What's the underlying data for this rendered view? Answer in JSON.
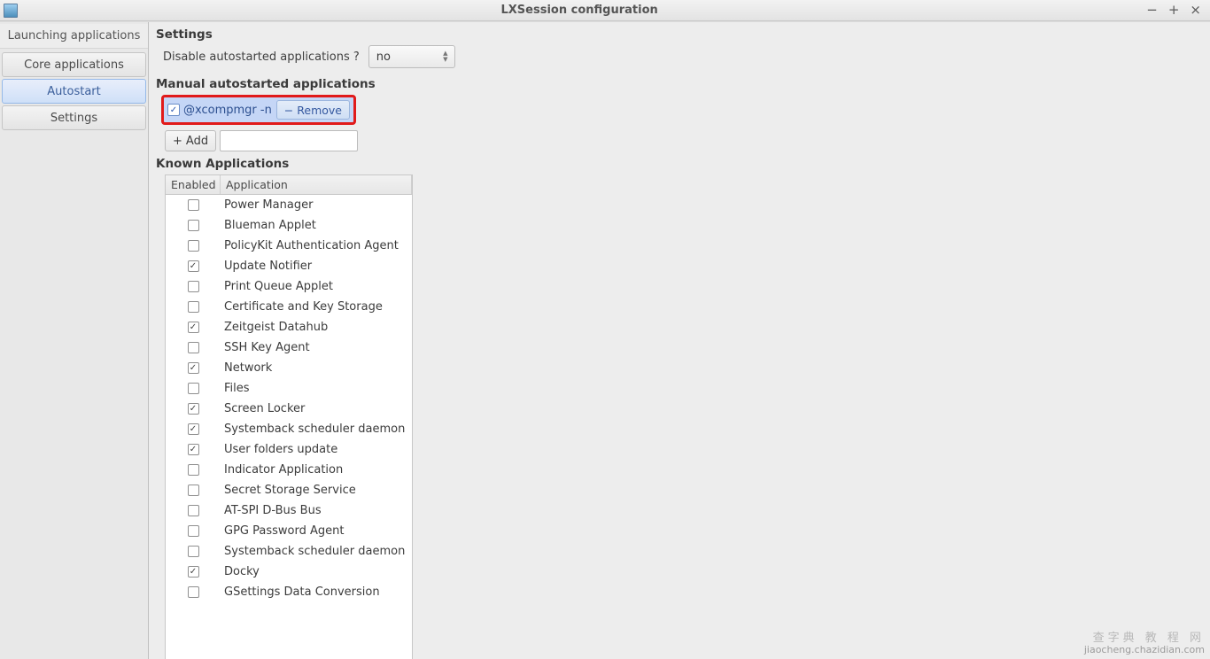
{
  "window": {
    "title": "LXSession configuration"
  },
  "sidebar": {
    "items": [
      {
        "label": "Launching applications",
        "kind": "top"
      },
      {
        "label": "Core applications",
        "kind": "normal"
      },
      {
        "label": "Autostart",
        "kind": "active"
      },
      {
        "label": "Settings",
        "kind": "normal"
      }
    ]
  },
  "settings": {
    "heading": "Settings",
    "disable_label": "Disable autostarted applications ?",
    "disable_value": "no"
  },
  "manual": {
    "heading": "Manual autostarted applications",
    "entry_label": "@xcompmgr -n",
    "entry_checked": true,
    "remove_label": "Remove",
    "add_label": "Add",
    "add_value": ""
  },
  "known": {
    "heading": "Known Applications",
    "col_enabled": "Enabled",
    "col_app": "Application",
    "rows": [
      {
        "enabled": false,
        "name": "Power Manager"
      },
      {
        "enabled": false,
        "name": "Blueman Applet"
      },
      {
        "enabled": false,
        "name": "PolicyKit Authentication Agent"
      },
      {
        "enabled": true,
        "name": "Update Notifier"
      },
      {
        "enabled": false,
        "name": "Print Queue Applet"
      },
      {
        "enabled": false,
        "name": "Certificate and Key Storage"
      },
      {
        "enabled": true,
        "name": "Zeitgeist Datahub"
      },
      {
        "enabled": false,
        "name": "SSH Key Agent"
      },
      {
        "enabled": true,
        "name": "Network"
      },
      {
        "enabled": false,
        "name": "Files"
      },
      {
        "enabled": true,
        "name": "Screen Locker"
      },
      {
        "enabled": true,
        "name": "Systemback scheduler daemon"
      },
      {
        "enabled": true,
        "name": "User folders update"
      },
      {
        "enabled": false,
        "name": "Indicator Application"
      },
      {
        "enabled": false,
        "name": "Secret Storage Service"
      },
      {
        "enabled": false,
        "name": "AT-SPI D-Bus Bus"
      },
      {
        "enabled": false,
        "name": "GPG Password Agent"
      },
      {
        "enabled": false,
        "name": "Systemback scheduler daemon"
      },
      {
        "enabled": true,
        "name": "Docky"
      },
      {
        "enabled": false,
        "name": "GSettings Data Conversion"
      }
    ]
  },
  "watermark": {
    "line1": "查字典  教 程 网",
    "line2": "jiaocheng.chazidian.com"
  }
}
